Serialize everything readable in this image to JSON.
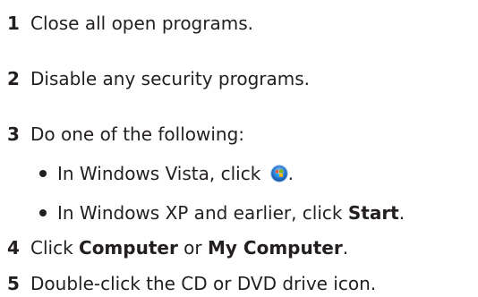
{
  "steps": [
    {
      "num": "1",
      "text": "Close all open programs."
    },
    {
      "num": "2",
      "text": "Disable any security programs."
    },
    {
      "num": "3",
      "text": "Do one of the following:"
    },
    {
      "num": "4",
      "text_parts": [
        "Click ",
        "Computer",
        " or ",
        "My Computer",
        "."
      ]
    },
    {
      "num": "5",
      "text": "Double-click the CD or DVD drive icon."
    }
  ],
  "bullets": [
    {
      "text_before": "In Windows Vista, click ",
      "icon": "windows-vista-start-orb-icon",
      "text_after": "."
    },
    {
      "text_before": "In Windows XP and earlier, click ",
      "bold": "Start",
      "text_after": "."
    }
  ],
  "colors": {
    "text": "#231f20",
    "orb_blue": "#2d7fd6",
    "orb_ring": "#9fc6ee"
  }
}
